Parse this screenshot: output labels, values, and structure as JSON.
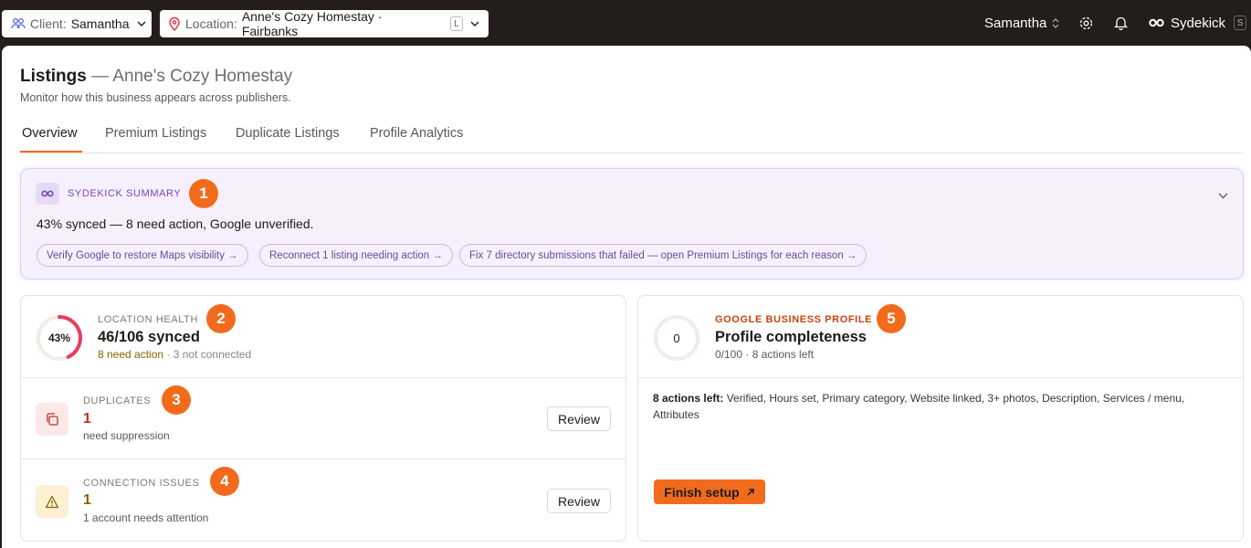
{
  "topbar": {
    "client_label": "Client:",
    "client_value": "Samantha",
    "location_label": "Location:",
    "location_value": "Anne's Cozy Homestay · Fairbanks",
    "location_shortcut": "L",
    "user_name": "Samantha",
    "sydekick_label": "Sydekick",
    "sydekick_shortcut": "S"
  },
  "page": {
    "title": "Listings",
    "title_sub": " — Anne's Cozy Homestay",
    "subtitle": "Monitor how this business appears across publishers."
  },
  "tabs": [
    {
      "label": "Overview",
      "active": true
    },
    {
      "label": "Premium Listings",
      "active": false
    },
    {
      "label": "Duplicate Listings",
      "active": false
    },
    {
      "label": "Profile Analytics",
      "active": false
    }
  ],
  "summary": {
    "label": "SYDEKICK SUMMARY",
    "text": "43% synced — 8 need action, Google unverified.",
    "chips": [
      "Verify Google to restore Maps visibility →",
      "Reconnect 1 listing needing action →",
      "Fix 7 directory submissions that failed — open Premium Listings for each reason →"
    ]
  },
  "badges": [
    "1",
    "2",
    "3",
    "4",
    "5"
  ],
  "health": {
    "label": "LOCATION HEALTH",
    "percent_label": "43%",
    "percent": 43,
    "synced": "46/106 synced",
    "need_action": "8 need action",
    "not_connected": " · 3 not connected"
  },
  "duplicates": {
    "label": "DUPLICATES",
    "count": "1",
    "desc": "need suppression",
    "button": "Review"
  },
  "connection": {
    "label": "CONNECTION ISSUES",
    "count": "1",
    "desc": "1 account needs attention",
    "button": "Review"
  },
  "gbp": {
    "label": "GOOGLE BUSINESS PROFILE",
    "score_label": "0",
    "score": 0,
    "title": "Profile completeness",
    "meta": "0/100 · 8 actions left",
    "actions_title": "8 actions left:",
    "actions_list": " Verified, Hours set, Primary category, Website linked, 3+ photos, Description, Services / menu, Attributes",
    "button": "Finish setup"
  },
  "colors": {
    "accent": "#f26b1d",
    "summary_purple": "#7a45b8",
    "health_ring": "#ea3c5e",
    "warning_text": "#8a6200",
    "duplicate_red": "#c0312c"
  },
  "icons": [
    "users-icon",
    "map-pin-icon",
    "chevron-down-icon",
    "chevron-up-down-icon",
    "gear-icon",
    "bell-icon",
    "sydekick-infinity-icon",
    "copy-icon",
    "warning-triangle-icon",
    "arrow-up-right-icon"
  ]
}
